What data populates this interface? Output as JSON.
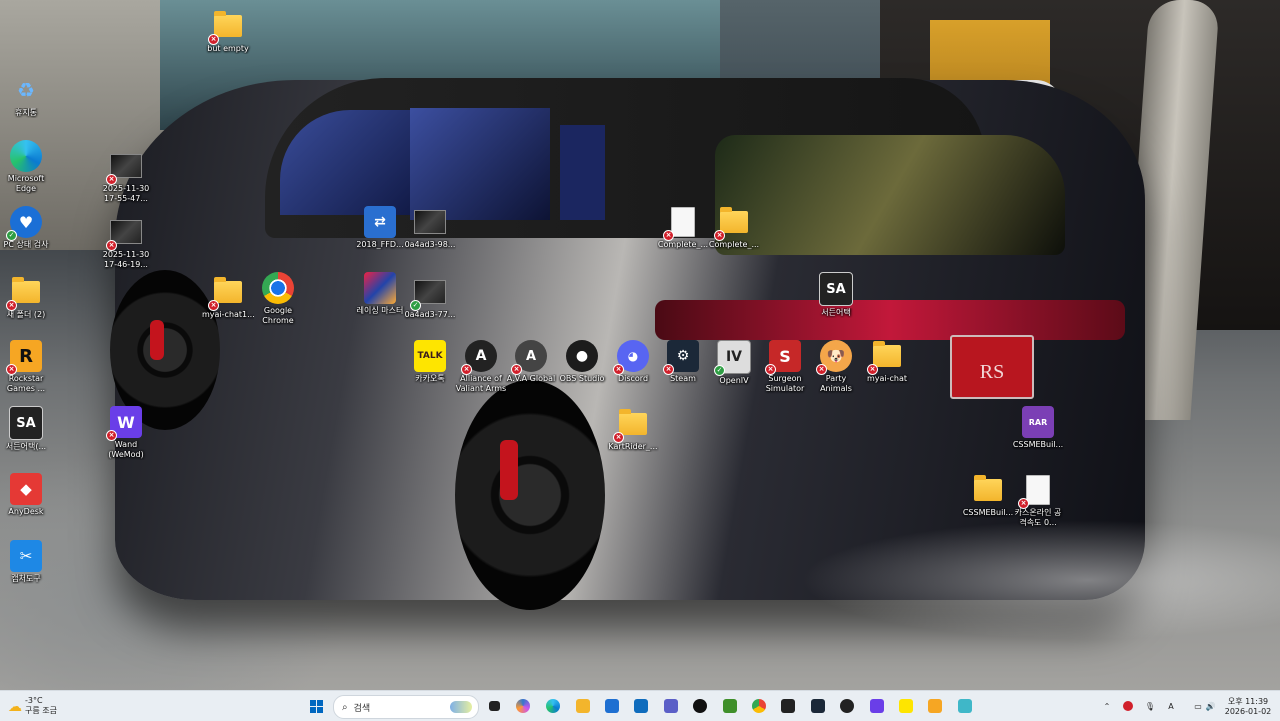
{
  "wallpaper": {
    "plate_text": "RS"
  },
  "desktop_icons": [
    {
      "id": "but-empty",
      "label": "but empty",
      "kind": "folder",
      "x_badge": true
    },
    {
      "id": "recycle",
      "label": "휴지통",
      "kind": "recycle"
    },
    {
      "id": "edge",
      "label": "Microsoft Edge",
      "kind": "edge"
    },
    {
      "id": "pc-health",
      "label": "PC 상태 검사",
      "kind": "health"
    },
    {
      "id": "folder-2",
      "label": "새 폴더 (2)",
      "kind": "folder",
      "x_badge": true
    },
    {
      "id": "rockstar",
      "label": "Rockstar Games ...",
      "kind": "rockstar",
      "x_badge": true
    },
    {
      "id": "seoreun-left",
      "label": "서든어택(...",
      "kind": "sa"
    },
    {
      "id": "anydesk",
      "label": "AnyDesk",
      "kind": "anydesk"
    },
    {
      "id": "capture",
      "label": "캡처도구",
      "kind": "capture"
    },
    {
      "id": "shot1",
      "label": "2025-11-30 17-55-47...",
      "kind": "shot",
      "x_badge": true
    },
    {
      "id": "shot2",
      "label": "2025-11-30 17-46-19...",
      "kind": "shot",
      "x_badge": true
    },
    {
      "id": "wand",
      "label": "Wand (WeMod)",
      "kind": "wand",
      "x_badge": true
    },
    {
      "id": "myai-chat1",
      "label": "myai-chat1...",
      "kind": "folder",
      "x_badge": true
    },
    {
      "id": "chrome",
      "label": "Google Chrome",
      "kind": "chrome"
    },
    {
      "id": "ffd",
      "label": "2018_FFD...",
      "kind": "ffd"
    },
    {
      "id": "shot3",
      "label": "0a4ad3-98...",
      "kind": "shot"
    },
    {
      "id": "racing",
      "label": "레이싱 마스터",
      "kind": "racing"
    },
    {
      "id": "shot4",
      "label": "0a4ad3-77...",
      "kind": "shot",
      "check_badge": true
    },
    {
      "id": "kakaotalk",
      "label": "카카오톡",
      "kind": "kakao"
    },
    {
      "id": "alliance",
      "label": "Alliance of Valiant Arms",
      "kind": "ava",
      "x_badge": true
    },
    {
      "id": "ava-global",
      "label": "A.V.A Global",
      "kind": "avag",
      "x_badge": true
    },
    {
      "id": "obs",
      "label": "OBS Studio",
      "kind": "obs"
    },
    {
      "id": "discord",
      "label": "Discord",
      "kind": "discord",
      "x_badge": true
    },
    {
      "id": "steam",
      "label": "Steam",
      "kind": "steam",
      "x_badge": true
    },
    {
      "id": "openiv",
      "label": "OpenIV",
      "kind": "openiv",
      "check_badge": true
    },
    {
      "id": "surgeon",
      "label": "Surgeon Simulator",
      "kind": "surgeon",
      "x_badge": true
    },
    {
      "id": "party",
      "label": "Party Animals",
      "kind": "party",
      "x_badge": true
    },
    {
      "id": "myai-chat",
      "label": "myai-chat",
      "kind": "folder",
      "x_badge": true
    },
    {
      "id": "complete1",
      "label": "Complete_...",
      "kind": "doc",
      "x_badge": true
    },
    {
      "id": "complete2",
      "label": "Complete_...",
      "kind": "folder",
      "x_badge": true
    },
    {
      "id": "seoreun",
      "label": "서든어택",
      "kind": "sa"
    },
    {
      "id": "kartrider",
      "label": "KartRider_...",
      "kind": "folder",
      "x_badge": true
    },
    {
      "id": "cssme-rar",
      "label": "CSSMEBuil...",
      "kind": "rar"
    },
    {
      "id": "cssme-folder",
      "label": "CSSMEBuil...",
      "kind": "folder"
    },
    {
      "id": "kas-doc",
      "label": "카스온라인 공격속도 0...",
      "kind": "doc",
      "x_badge": true
    }
  ],
  "taskbar": {
    "weather_temp": "-3°C",
    "weather_desc": "구름 조금",
    "search_placeholder": "검색",
    "clock_ampm_time": "오후 11:39",
    "clock_date": "2026-01-02",
    "ime": "A",
    "apps": [
      "task-view",
      "copilot",
      "edge",
      "file-explorer",
      "store",
      "outlook",
      "teams",
      "capcut",
      "minecraft",
      "chrome",
      "epic",
      "steam",
      "obs",
      "wand",
      "kakaotalk",
      "rockstar",
      "notepad"
    ],
    "colors": {
      "taskbar_bg": "#e9eef3",
      "accent": "#0067c0"
    }
  }
}
